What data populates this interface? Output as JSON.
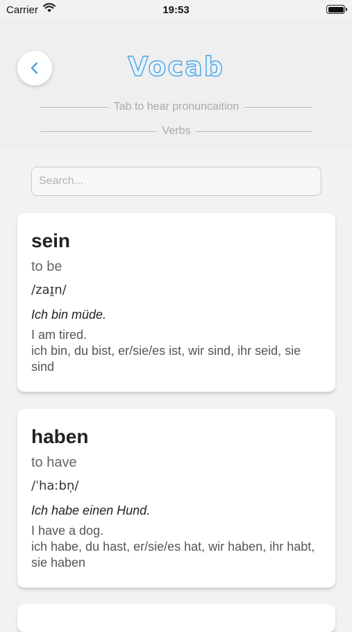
{
  "status_bar": {
    "carrier": "Carrier",
    "time": "19:53"
  },
  "header": {
    "title": "Vocab",
    "hint": "Tab to hear pronuncaition",
    "category": "Verbs"
  },
  "search": {
    "placeholder": "Search...",
    "value": ""
  },
  "entries": [
    {
      "word": "sein",
      "meaning": "to be",
      "ipa": "/zaɪ̯n/",
      "example": "Ich bin müde.",
      "translation": "I am tired.",
      "conjugation": "ich bin, du bist, er/sie/es ist, wir sind, ihr seid, sie sind"
    },
    {
      "word": "haben",
      "meaning": "to have",
      "ipa": "/ˈhaːbn̩/",
      "example": "Ich habe einen Hund.",
      "translation": "I have a dog.",
      "conjugation": "ich habe, du hast, er/sie/es hat, wir haben, ihr habt, sie haben"
    }
  ],
  "colors": {
    "accent": "#4ba3e0",
    "background": "#f2f2f2",
    "card": "#ffffff"
  },
  "icons": {
    "back": "chevron-left-icon",
    "wifi": "wifi-icon",
    "battery": "battery-icon"
  }
}
